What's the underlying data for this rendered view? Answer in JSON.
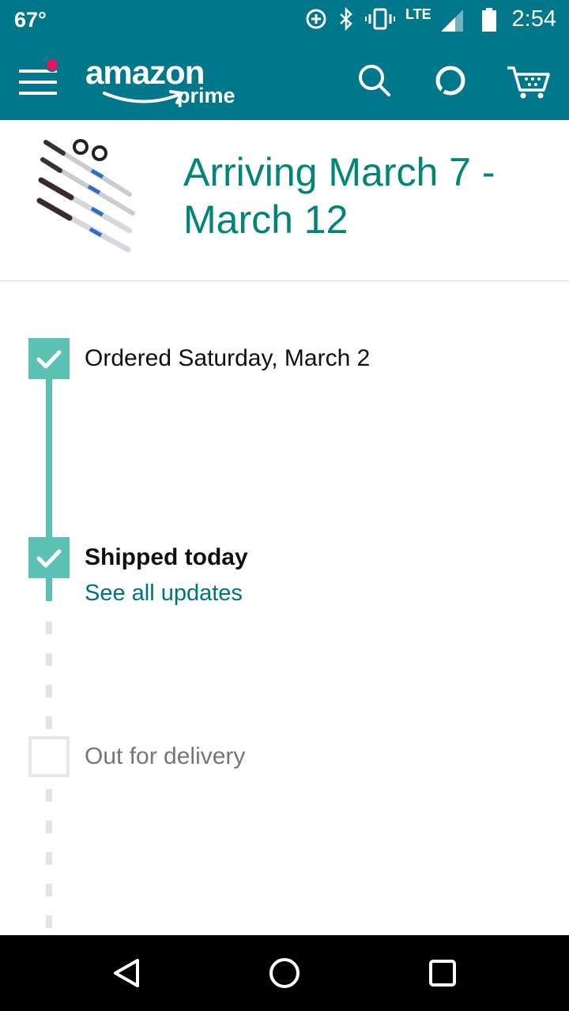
{
  "status_bar": {
    "temperature": "67°",
    "network": "LTE",
    "time": "2:54",
    "icons": [
      "data-saver-icon",
      "bluetooth-icon",
      "vibrate-icon",
      "signal-icon",
      "battery-icon"
    ]
  },
  "header": {
    "logo_word": "amazon",
    "logo_sub": "prime",
    "icons": [
      "menu-icon",
      "search-icon",
      "alexa-icon",
      "cart-icon"
    ],
    "brand_color": "#00778a"
  },
  "arrival": {
    "title": "Arriving March 7 - March 12",
    "accent_color": "#008577"
  },
  "timeline": {
    "steps": [
      {
        "label": "Ordered Saturday, March 2",
        "status": "done"
      },
      {
        "label": "Shipped today",
        "status": "done",
        "link": "See all updates"
      },
      {
        "label": "Out for delivery",
        "status": "pending"
      }
    ],
    "done_color": "#5bc2b3"
  },
  "nav_bar": {
    "icons": [
      "back-icon",
      "home-icon",
      "recents-icon"
    ]
  }
}
